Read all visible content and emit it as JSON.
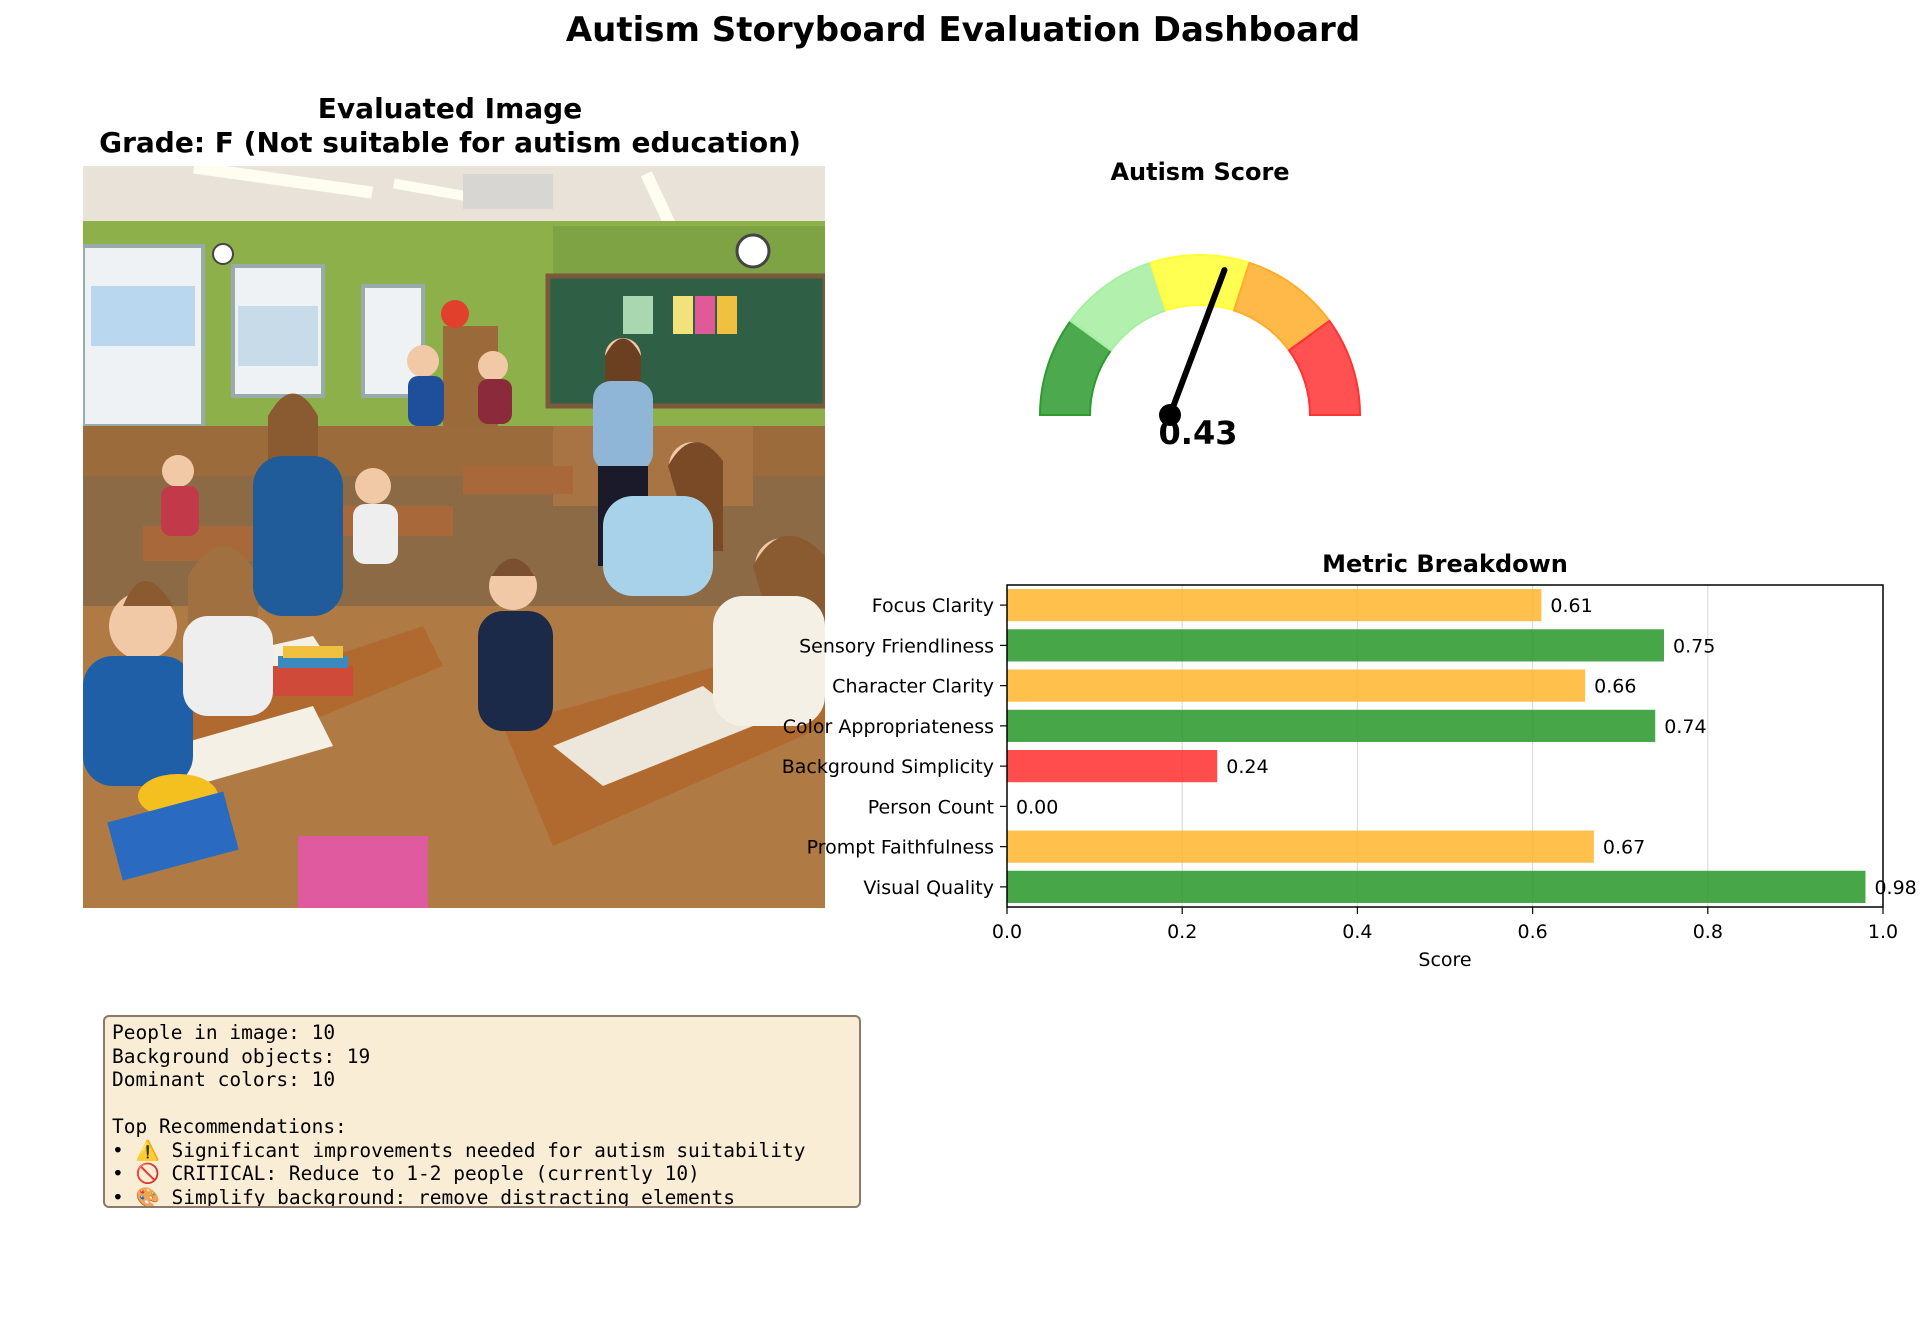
{
  "title": "Autism Storyboard Evaluation Dashboard",
  "image_panel": {
    "title_line1": "Evaluated Image",
    "title_line2": "Grade: F (Not suitable for autism education)",
    "image_description_icon": "classroom-photo"
  },
  "gauge": {
    "title": "Autism Score",
    "value": 0.43,
    "value_label": "0.43",
    "bands": [
      {
        "color": "#2e9a2e"
      },
      {
        "color": "#a5ef9f"
      },
      {
        "color": "#ffff33"
      },
      {
        "color": "#ffad29"
      },
      {
        "color": "#ff3333"
      }
    ]
  },
  "chart_data": {
    "type": "bar",
    "orientation": "horizontal",
    "title": "Metric Breakdown",
    "xlabel": "Score",
    "ylabel": "",
    "xlim": [
      0,
      1.0
    ],
    "xticks": [
      "0.0",
      "0.2",
      "0.4",
      "0.6",
      "0.8",
      "1.0"
    ],
    "grid": "vertical",
    "categories": [
      "Focus Clarity",
      "Sensory Friendliness",
      "Character Clarity",
      "Color Appropriateness",
      "Background Simplicity",
      "Person Count",
      "Prompt Faithfulness",
      "Visual Quality"
    ],
    "values": [
      0.61,
      0.75,
      0.66,
      0.74,
      0.24,
      0.0,
      0.67,
      0.98
    ],
    "value_labels": [
      "0.61",
      "0.75",
      "0.66",
      "0.74",
      "0.24",
      "0.00",
      "0.67",
      "0.98"
    ],
    "colors": [
      "#ffb733",
      "#2e9a2e",
      "#ffb733",
      "#2e9a2e",
      "#ff3333",
      "#ff3333",
      "#ffb733",
      "#2e9a2e"
    ]
  },
  "info": {
    "lines": [
      "People in image: 10",
      "Background objects: 19",
      "Dominant colors: 10",
      "",
      "Top Recommendations:",
      "• ⚠️ Significant improvements needed for autism suitability",
      "• 🚫 CRITICAL: Reduce to 1-2 people (currently 10)",
      "• 🎨 Simplify background: remove distracting elements"
    ]
  }
}
